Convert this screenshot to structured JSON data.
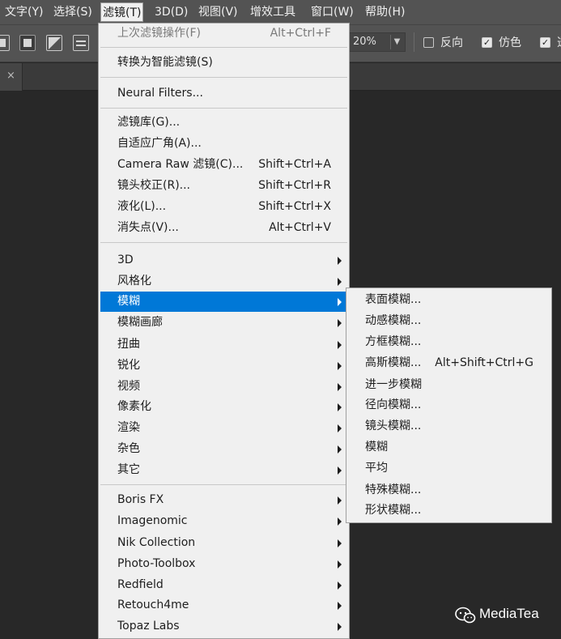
{
  "menubar": {
    "items": [
      {
        "label": "文字(Y)"
      },
      {
        "label": "选择(S)"
      },
      {
        "label": "滤镜(T)"
      },
      {
        "label": "3D(D)"
      },
      {
        "label": "视图(V)"
      },
      {
        "label": "增效工具"
      },
      {
        "label": "窗口(W)"
      },
      {
        "label": "帮助(H)"
      }
    ],
    "active_label": "滤镜(T)"
  },
  "options_bar": {
    "zoom_value": "20%",
    "checkboxes": [
      {
        "label": "反向",
        "checked": false
      },
      {
        "label": "仿色",
        "checked": true
      },
      {
        "label": "透",
        "checked": true
      }
    ]
  },
  "tab": {
    "close_glyph": "×"
  },
  "filter_menu": {
    "last_filter": {
      "label": "上次滤镜操作(F)",
      "shortcut": "Alt+Ctrl+F"
    },
    "smart_filter": {
      "label": "转换为智能滤镜(S)"
    },
    "neural": {
      "label": "Neural Filters..."
    },
    "group1": [
      {
        "label": "滤镜库(G)...",
        "shortcut": ""
      },
      {
        "label": "自适应广角(A)...",
        "shortcut": ""
      },
      {
        "label": "Camera Raw 滤镜(C)...",
        "shortcut": "Shift+Ctrl+A"
      },
      {
        "label": "镜头校正(R)...",
        "shortcut": "Shift+Ctrl+R"
      },
      {
        "label": "液化(L)...",
        "shortcut": "Shift+Ctrl+X"
      },
      {
        "label": "消失点(V)...",
        "shortcut": "Alt+Ctrl+V"
      }
    ],
    "group2": [
      {
        "label": "3D"
      },
      {
        "label": "风格化"
      },
      {
        "label": "模糊"
      },
      {
        "label": "模糊画廊"
      },
      {
        "label": "扭曲"
      },
      {
        "label": "锐化"
      },
      {
        "label": "视频"
      },
      {
        "label": "像素化"
      },
      {
        "label": "渲染"
      },
      {
        "label": "杂色"
      },
      {
        "label": "其它"
      }
    ],
    "highlighted": "模糊",
    "plugins": [
      {
        "label": "Boris FX"
      },
      {
        "label": "Imagenomic"
      },
      {
        "label": "Nik Collection"
      },
      {
        "label": "Photo-Toolbox"
      },
      {
        "label": "Redfield"
      },
      {
        "label": "Retouch4me"
      },
      {
        "label": "Topaz Labs"
      }
    ]
  },
  "blur_submenu": {
    "items": [
      {
        "label": "表面模糊...",
        "shortcut": ""
      },
      {
        "label": "动感模糊...",
        "shortcut": ""
      },
      {
        "label": "方框模糊...",
        "shortcut": ""
      },
      {
        "label": "高斯模糊...",
        "shortcut": "Alt+Shift+Ctrl+G"
      },
      {
        "label": "进一步模糊",
        "shortcut": ""
      },
      {
        "label": "径向模糊...",
        "shortcut": ""
      },
      {
        "label": "镜头模糊...",
        "shortcut": ""
      },
      {
        "label": "模糊",
        "shortcut": ""
      },
      {
        "label": "平均",
        "shortcut": ""
      },
      {
        "label": "特殊模糊...",
        "shortcut": ""
      },
      {
        "label": "形状模糊...",
        "shortcut": ""
      }
    ]
  },
  "watermark": {
    "text": "MediaTea"
  },
  "colors": {
    "menu_highlight": "#0078d7",
    "menu_bg": "#f0f0f0",
    "workspace_bg": "#282828",
    "toolbar_bg": "#535353"
  }
}
